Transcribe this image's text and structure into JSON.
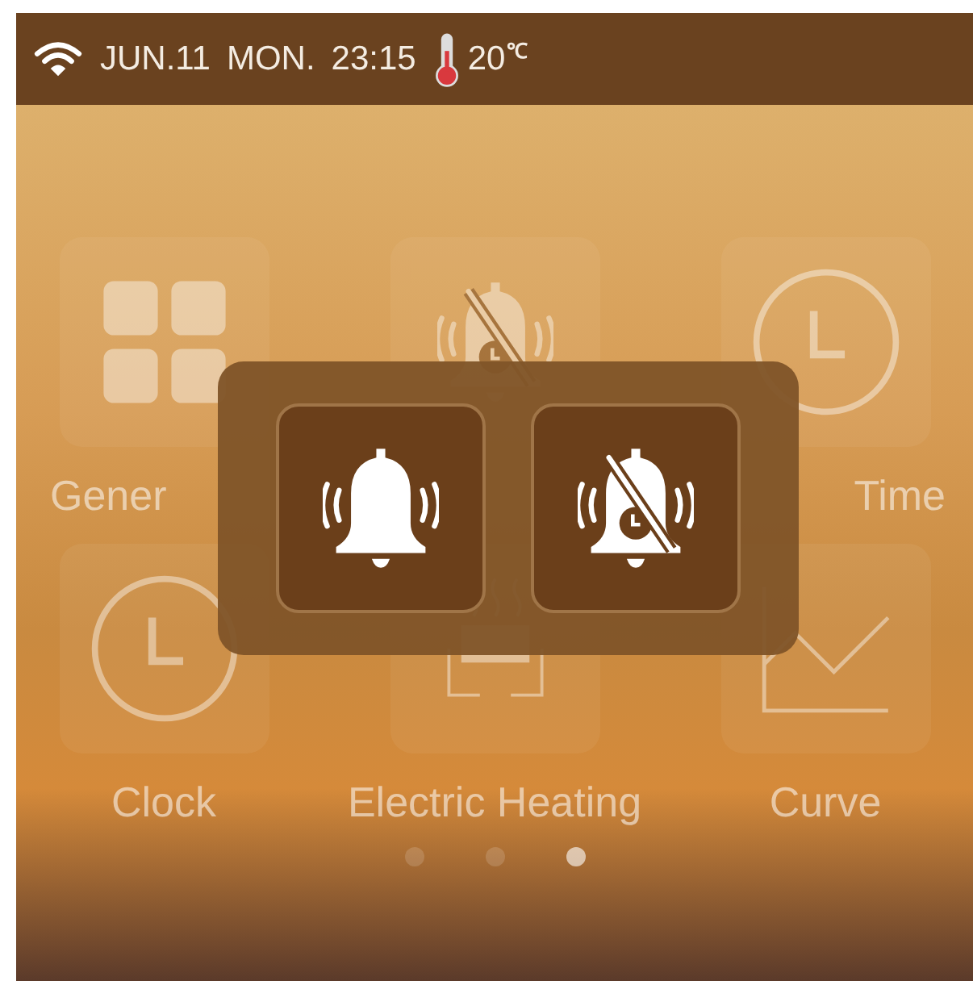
{
  "status_bar": {
    "date": "JUN.11",
    "day": "MON.",
    "time": "23:15",
    "temperature": "20",
    "temperature_unit": "℃"
  },
  "tiles": [
    {
      "kind": "general",
      "label": "Gener"
    },
    {
      "kind": "mute"
    },
    {
      "kind": "clock",
      "label": "Time"
    },
    {
      "kind": "clock",
      "label": "Clock"
    },
    {
      "kind": "heating",
      "label": "Electric Heating"
    },
    {
      "kind": "curve",
      "label": "Curve"
    }
  ],
  "dialog": {
    "buttons": [
      {
        "kind": "ring"
      },
      {
        "kind": "silent"
      }
    ]
  },
  "page_dots": [
    {
      "selected": false
    },
    {
      "selected": false
    },
    {
      "selected": true
    }
  ]
}
